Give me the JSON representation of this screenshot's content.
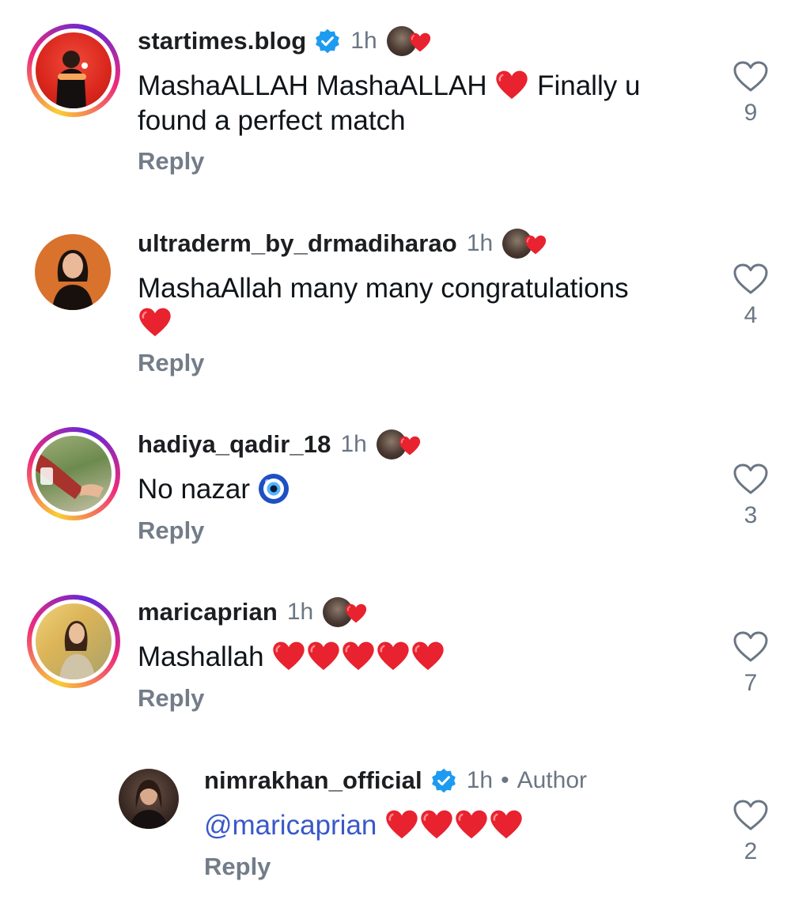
{
  "comments": [
    {
      "username": "startimes.blog",
      "verified": true,
      "time": "1h",
      "text": "MashaALLAH MashaALLAH",
      "text_after": "Finally u found a perfect match",
      "reply_label": "Reply",
      "likes": "9"
    },
    {
      "username": "ultraderm_by_drmadiharao",
      "verified": false,
      "time": "1h",
      "text": "MashaAllah many many congratulations",
      "reply_label": "Reply",
      "likes": "4"
    },
    {
      "username": "hadiya_qadir_18",
      "verified": false,
      "time": "1h",
      "text": "No nazar",
      "reply_label": "Reply",
      "likes": "3"
    },
    {
      "username": "maricaprian",
      "verified": false,
      "time": "1h",
      "text": "Mashallah",
      "reply_label": "Reply",
      "likes": "7"
    }
  ],
  "reply": {
    "username": "nimrakhan_official",
    "verified": true,
    "time": "1h",
    "separator": "•",
    "author_label": "Author",
    "mention": "@maricaprian",
    "reply_label": "Reply",
    "likes": "2"
  },
  "colors": {
    "verified_badge": "#1d9bf0",
    "heart_red": "#e8222e",
    "mention_blue": "#3a58c9",
    "muted_text": "#737d89"
  }
}
